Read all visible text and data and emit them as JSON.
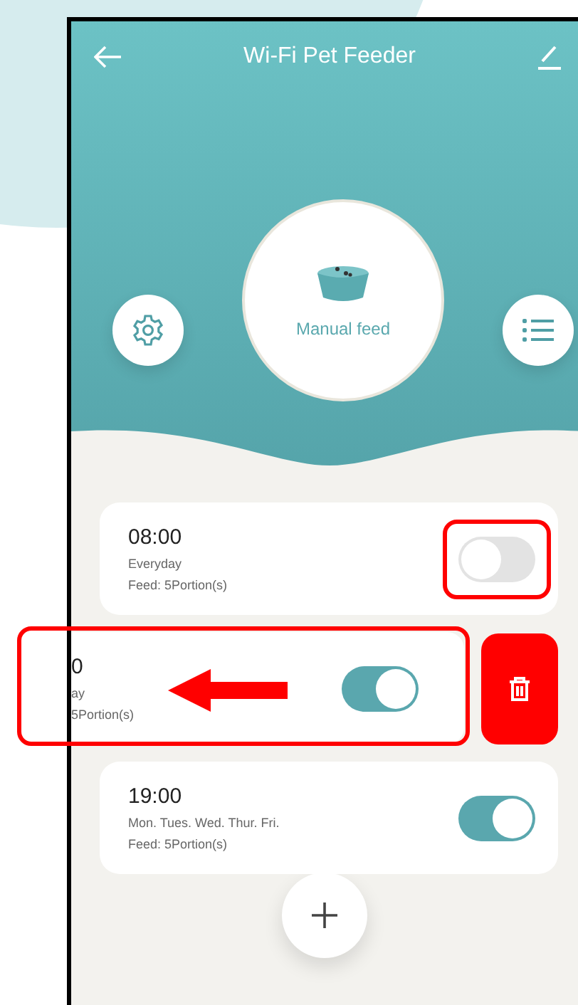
{
  "header": {
    "title": "Wi-Fi Pet Feeder",
    "manual_feed": "Manual feed"
  },
  "schedules": [
    {
      "kind": "card",
      "time": "08:00",
      "repeat": "Everyday",
      "feed": "Feed: 5Portion(s)",
      "on": false,
      "marked": true
    },
    {
      "kind": "swiped",
      "time": "0",
      "repeat": "ay",
      "feed": "5Portion(s)",
      "on": true,
      "marked": true
    },
    {
      "kind": "card",
      "time": "19:00",
      "repeat": "Mon. Tues. Wed. Thur. Fri.",
      "feed": "Feed: 5Portion(s)",
      "on": true,
      "marked": false
    }
  ]
}
